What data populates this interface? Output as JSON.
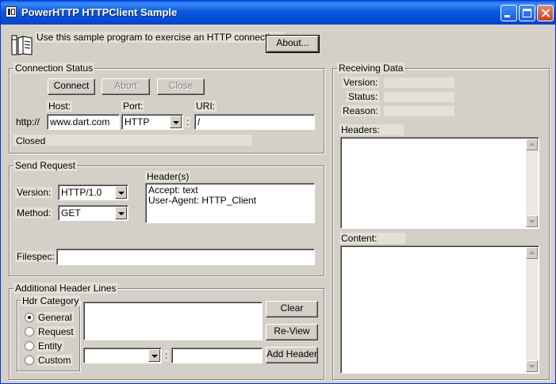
{
  "window": {
    "title": "PowerHTTP HTTPClient Sample"
  },
  "intro": {
    "text": "Use this sample program to exercise an HTTP connection.",
    "about_label": "About..."
  },
  "connection": {
    "group_title": "Connection Status",
    "connect_label": "Connect",
    "abort_label": "Abort",
    "close_label": "Close",
    "host_label": "Host:",
    "port_label": "Port:",
    "uri_label": "URI:",
    "scheme_prefix": "http://",
    "host_value": "www.dart.com",
    "port_value": "HTTP",
    "port_separator": ":",
    "uri_value": "/",
    "status_text": "Closed"
  },
  "send_request": {
    "group_title": "Send Request",
    "version_label": "Version:",
    "version_value": "HTTP/1.0",
    "method_label": "Method:",
    "method_value": "GET",
    "headers_label": "Header(s)",
    "headers_lines": [
      "Accept: text",
      "User-Agent: HTTP_Client"
    ],
    "filespec_label": "Filespec:",
    "filespec_value": ""
  },
  "additional_headers": {
    "group_title": "Additional Header Lines",
    "category_title": "Hdr Category",
    "categories": [
      "General",
      "Request",
      "Entity",
      "Custom"
    ],
    "selected_category": "General",
    "clear_label": "Clear",
    "review_label": "Re-View",
    "add_header_label": "Add Header",
    "name_value": "",
    "separator": ":",
    "value_value": ""
  },
  "receiving": {
    "group_title": "Receiving Data",
    "version_label": "Version:",
    "status_label": "Status:",
    "reason_label": "Reason:",
    "version_value": "",
    "status_value": "",
    "reason_value": "",
    "headers_label": "Headers:",
    "content_label": "Content:"
  }
}
